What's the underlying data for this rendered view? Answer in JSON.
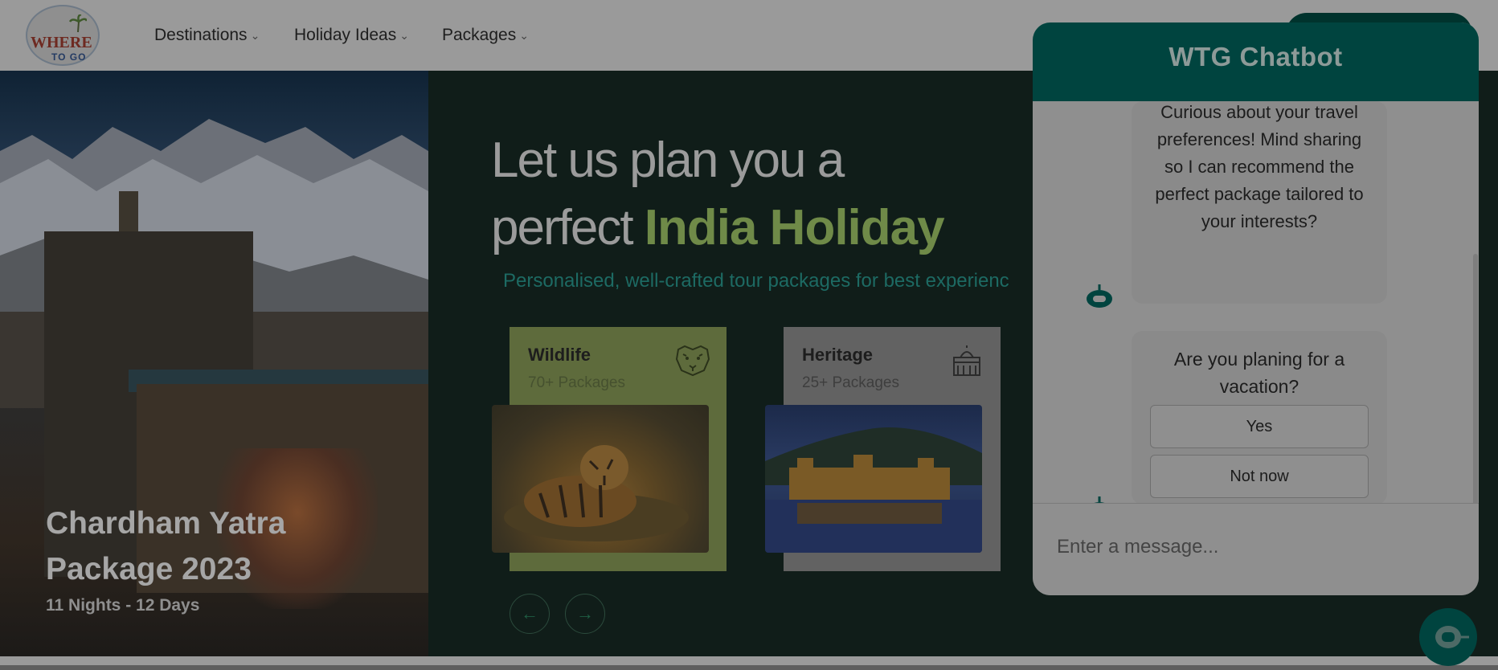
{
  "header": {
    "logo_text_top": "WHERE",
    "logo_text_bottom": "TO GO",
    "nav": [
      {
        "label": "Destinations"
      },
      {
        "label": "Holiday Ideas"
      },
      {
        "label": "Packages"
      }
    ]
  },
  "hero": {
    "title": "Chardham Yatra Package 2023",
    "subtitle": "11 Nights - 12 Days"
  },
  "main": {
    "headline_part1": "Let us plan you a",
    "headline_part2": "perfect ",
    "headline_accent": "India Holiday",
    "tagline": "Personalised, well-crafted tour packages for best experienc",
    "cards": [
      {
        "title": "Wildlife",
        "count": "70+ Packages",
        "icon": "tiger-icon"
      },
      {
        "title": "Heritage",
        "count": "25+ Packages",
        "icon": "monument-icon"
      }
    ],
    "prev_arrow": "←",
    "next_arrow": "→"
  },
  "chatbot": {
    "title": "WTG Chatbot",
    "messages": [
      {
        "text": "Curious about your travel preferences! Mind sharing so I can recommend the perfect package tailored to your interests?"
      },
      {
        "text": "Are you planing for a vacation?",
        "options": [
          "Yes",
          "Not now"
        ]
      }
    ],
    "input_placeholder": "Enter a message..."
  },
  "colors": {
    "accent_green": "#6f8a48",
    "chat_header": "#00443f",
    "hero_background": "#101d19"
  }
}
